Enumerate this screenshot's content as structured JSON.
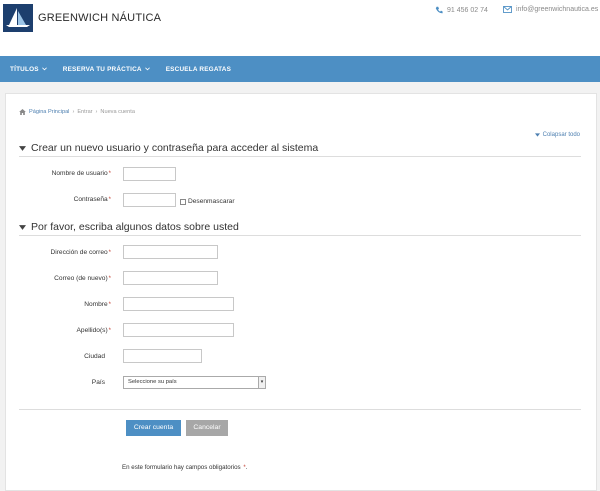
{
  "brand": {
    "name": "GREENWICH NÁUTICA",
    "logo_caption": "GREENWICH"
  },
  "contact": {
    "phone": "91 456 02 74",
    "email": "info@greenwichnautica.es"
  },
  "nav": [
    {
      "label": "TÍTULOS",
      "has_dropdown": true
    },
    {
      "label": "RESERVA TU PRÁCTICA",
      "has_dropdown": true
    },
    {
      "label": "ESCUELA REGATAS",
      "has_dropdown": false
    }
  ],
  "breadcrumb": {
    "home": "Página Principal",
    "items": [
      "Entrar",
      "Nueva cuenta"
    ],
    "separator": "›"
  },
  "collapse_all": "Colapsar todo",
  "section1": {
    "title": "Crear un nuevo usuario y contraseña para acceder al sistema",
    "username_label": "Nombre de usuario",
    "password_label": "Contraseña",
    "unmask_label": "Desenmascarar"
  },
  "section2": {
    "title": "Por favor, escriba algunos datos sobre usted",
    "email_label": "Dirección de correo",
    "email2_label": "Correo (de nuevo)",
    "firstname_label": "Nombre",
    "lastname_label": "Apellido(s)",
    "city_label": "Ciudad",
    "country_label": "País",
    "country_value": "Seleccione su país"
  },
  "required_mark": "*",
  "buttons": {
    "create": "Crear cuenta",
    "cancel": "Cancelar"
  },
  "required_note": "En este formulario hay campos obligatorios",
  "colors": {
    "accent": "#4d8fc4",
    "required": "#c0392b",
    "logo_bg": "#1d3f6e"
  }
}
